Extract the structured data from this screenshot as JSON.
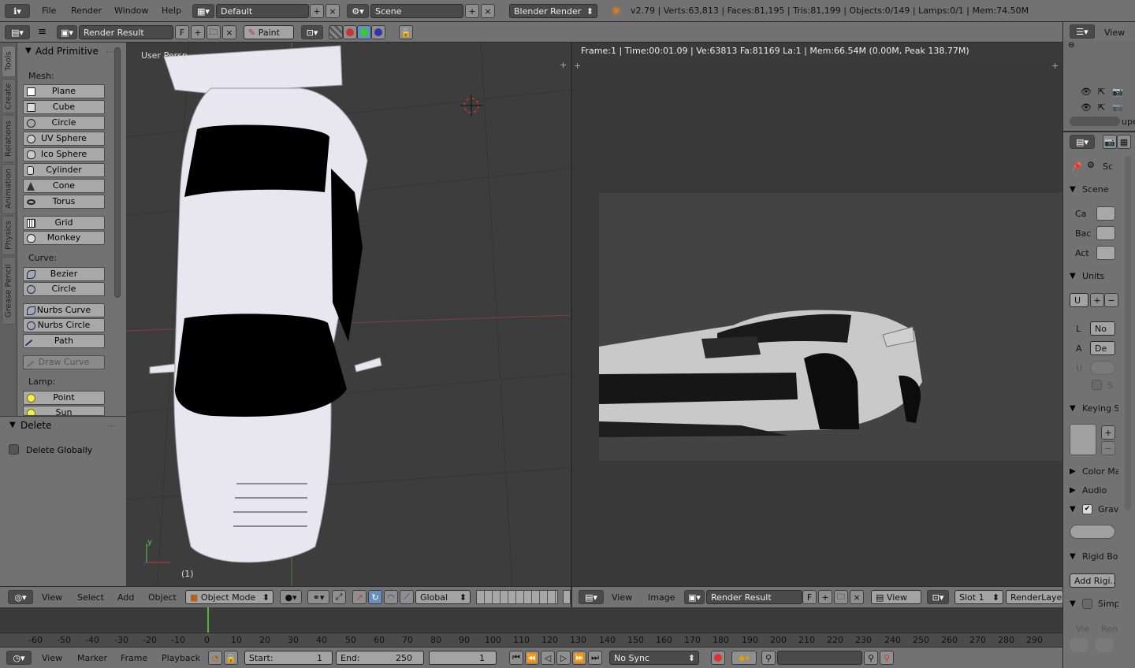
{
  "topbar": {
    "menu": [
      "File",
      "Render",
      "Window",
      "Help"
    ],
    "screen_layout": "Default",
    "scene": "Scene",
    "engine": "Blender Render",
    "stats": "v2.79 | Verts:63,813 | Faces:81,195 | Tris:81,199 | Objects:0/149 | Lamps:0/1 | Mem:74.50M"
  },
  "image_header": {
    "image_name": "Render Result",
    "f_label": "F",
    "paint_mode": "Paint"
  },
  "toolshelf": {
    "tabs": [
      "Tools",
      "Create",
      "Relations",
      "Animation",
      "Physics",
      "Grease Pencil"
    ],
    "panel_title": "Add Primitive",
    "mesh_label": "Mesh:",
    "mesh_items": [
      "Plane",
      "Cube",
      "Circle",
      "UV Sphere",
      "Ico Sphere",
      "Cylinder",
      "Cone",
      "Torus"
    ],
    "mesh_items2": [
      "Grid",
      "Monkey"
    ],
    "curve_label": "Curve:",
    "curve_items": [
      "Bezier",
      "Circle"
    ],
    "curve_items2": [
      "Nurbs Curve",
      "Nurbs Circle",
      "Path"
    ],
    "draw_curve": "Draw Curve",
    "lamp_label": "Lamp:",
    "lamp_items": [
      "Point",
      "Sun"
    ],
    "operator_title": "Delete",
    "operator_option": "Delete Globally"
  },
  "viewport": {
    "label": "User Persp",
    "frame_number": "(1)",
    "axis_y": "y",
    "menu": [
      "View",
      "Select",
      "Add",
      "Object"
    ],
    "mode": "Object Mode",
    "orientation": "Global"
  },
  "image_editor": {
    "info": "Frame:1 | Time:00:01.09 | Ve:63813 Fa:81169 La:1 | Mem:66.54M (0.00M, Peak 138.77M)",
    "menu": [
      "View",
      "Image"
    ],
    "image_name": "Render Result",
    "f_label": "F",
    "view": "View",
    "slot": "Slot 1",
    "render_layer": "RenderLayer"
  },
  "timeline": {
    "ticks": [
      "-60",
      "-50",
      "-40",
      "-30",
      "-20",
      "-10",
      "0",
      "10",
      "20",
      "30",
      "40",
      "50",
      "60",
      "70",
      "80",
      "90",
      "100",
      "110",
      "120",
      "130",
      "140",
      "150",
      "160",
      "170",
      "180",
      "190",
      "200",
      "210",
      "220",
      "230",
      "240",
      "250",
      "260",
      "270",
      "280",
      "290"
    ],
    "menu": [
      "View",
      "Marker",
      "Frame",
      "Playback"
    ],
    "start_label": "Start:",
    "start_value": "1",
    "end_label": "End:",
    "end_value": "250",
    "current_frame": "1",
    "sync": "No Sync"
  },
  "outliner": {
    "view_label": "View",
    "truncated": "upe"
  },
  "properties": {
    "context": "Sc",
    "scene_panel": "Scene",
    "rows": [
      "Ca",
      "Bac",
      "Act"
    ],
    "units_panel": "Units",
    "units_value": "U",
    "length_label": "L",
    "length_value": "No",
    "angle_label": "A",
    "angle_value": "De",
    "u_label": "U",
    "s_label": "S",
    "keying": "Keying S",
    "color_management": "Color Ma",
    "audio": "Audio",
    "gravity": "Gravi",
    "rigid_body": "Rigid Bo",
    "add_rigid": "Add Rigi...",
    "simplify": "Simpl",
    "vie": "Vie",
    "ren": "Ren"
  },
  "colors": {
    "header": "#727272",
    "viewport_bg": "#3d3d3d",
    "x_axis": "#a33c3c",
    "frame_marker": "#54b936"
  }
}
